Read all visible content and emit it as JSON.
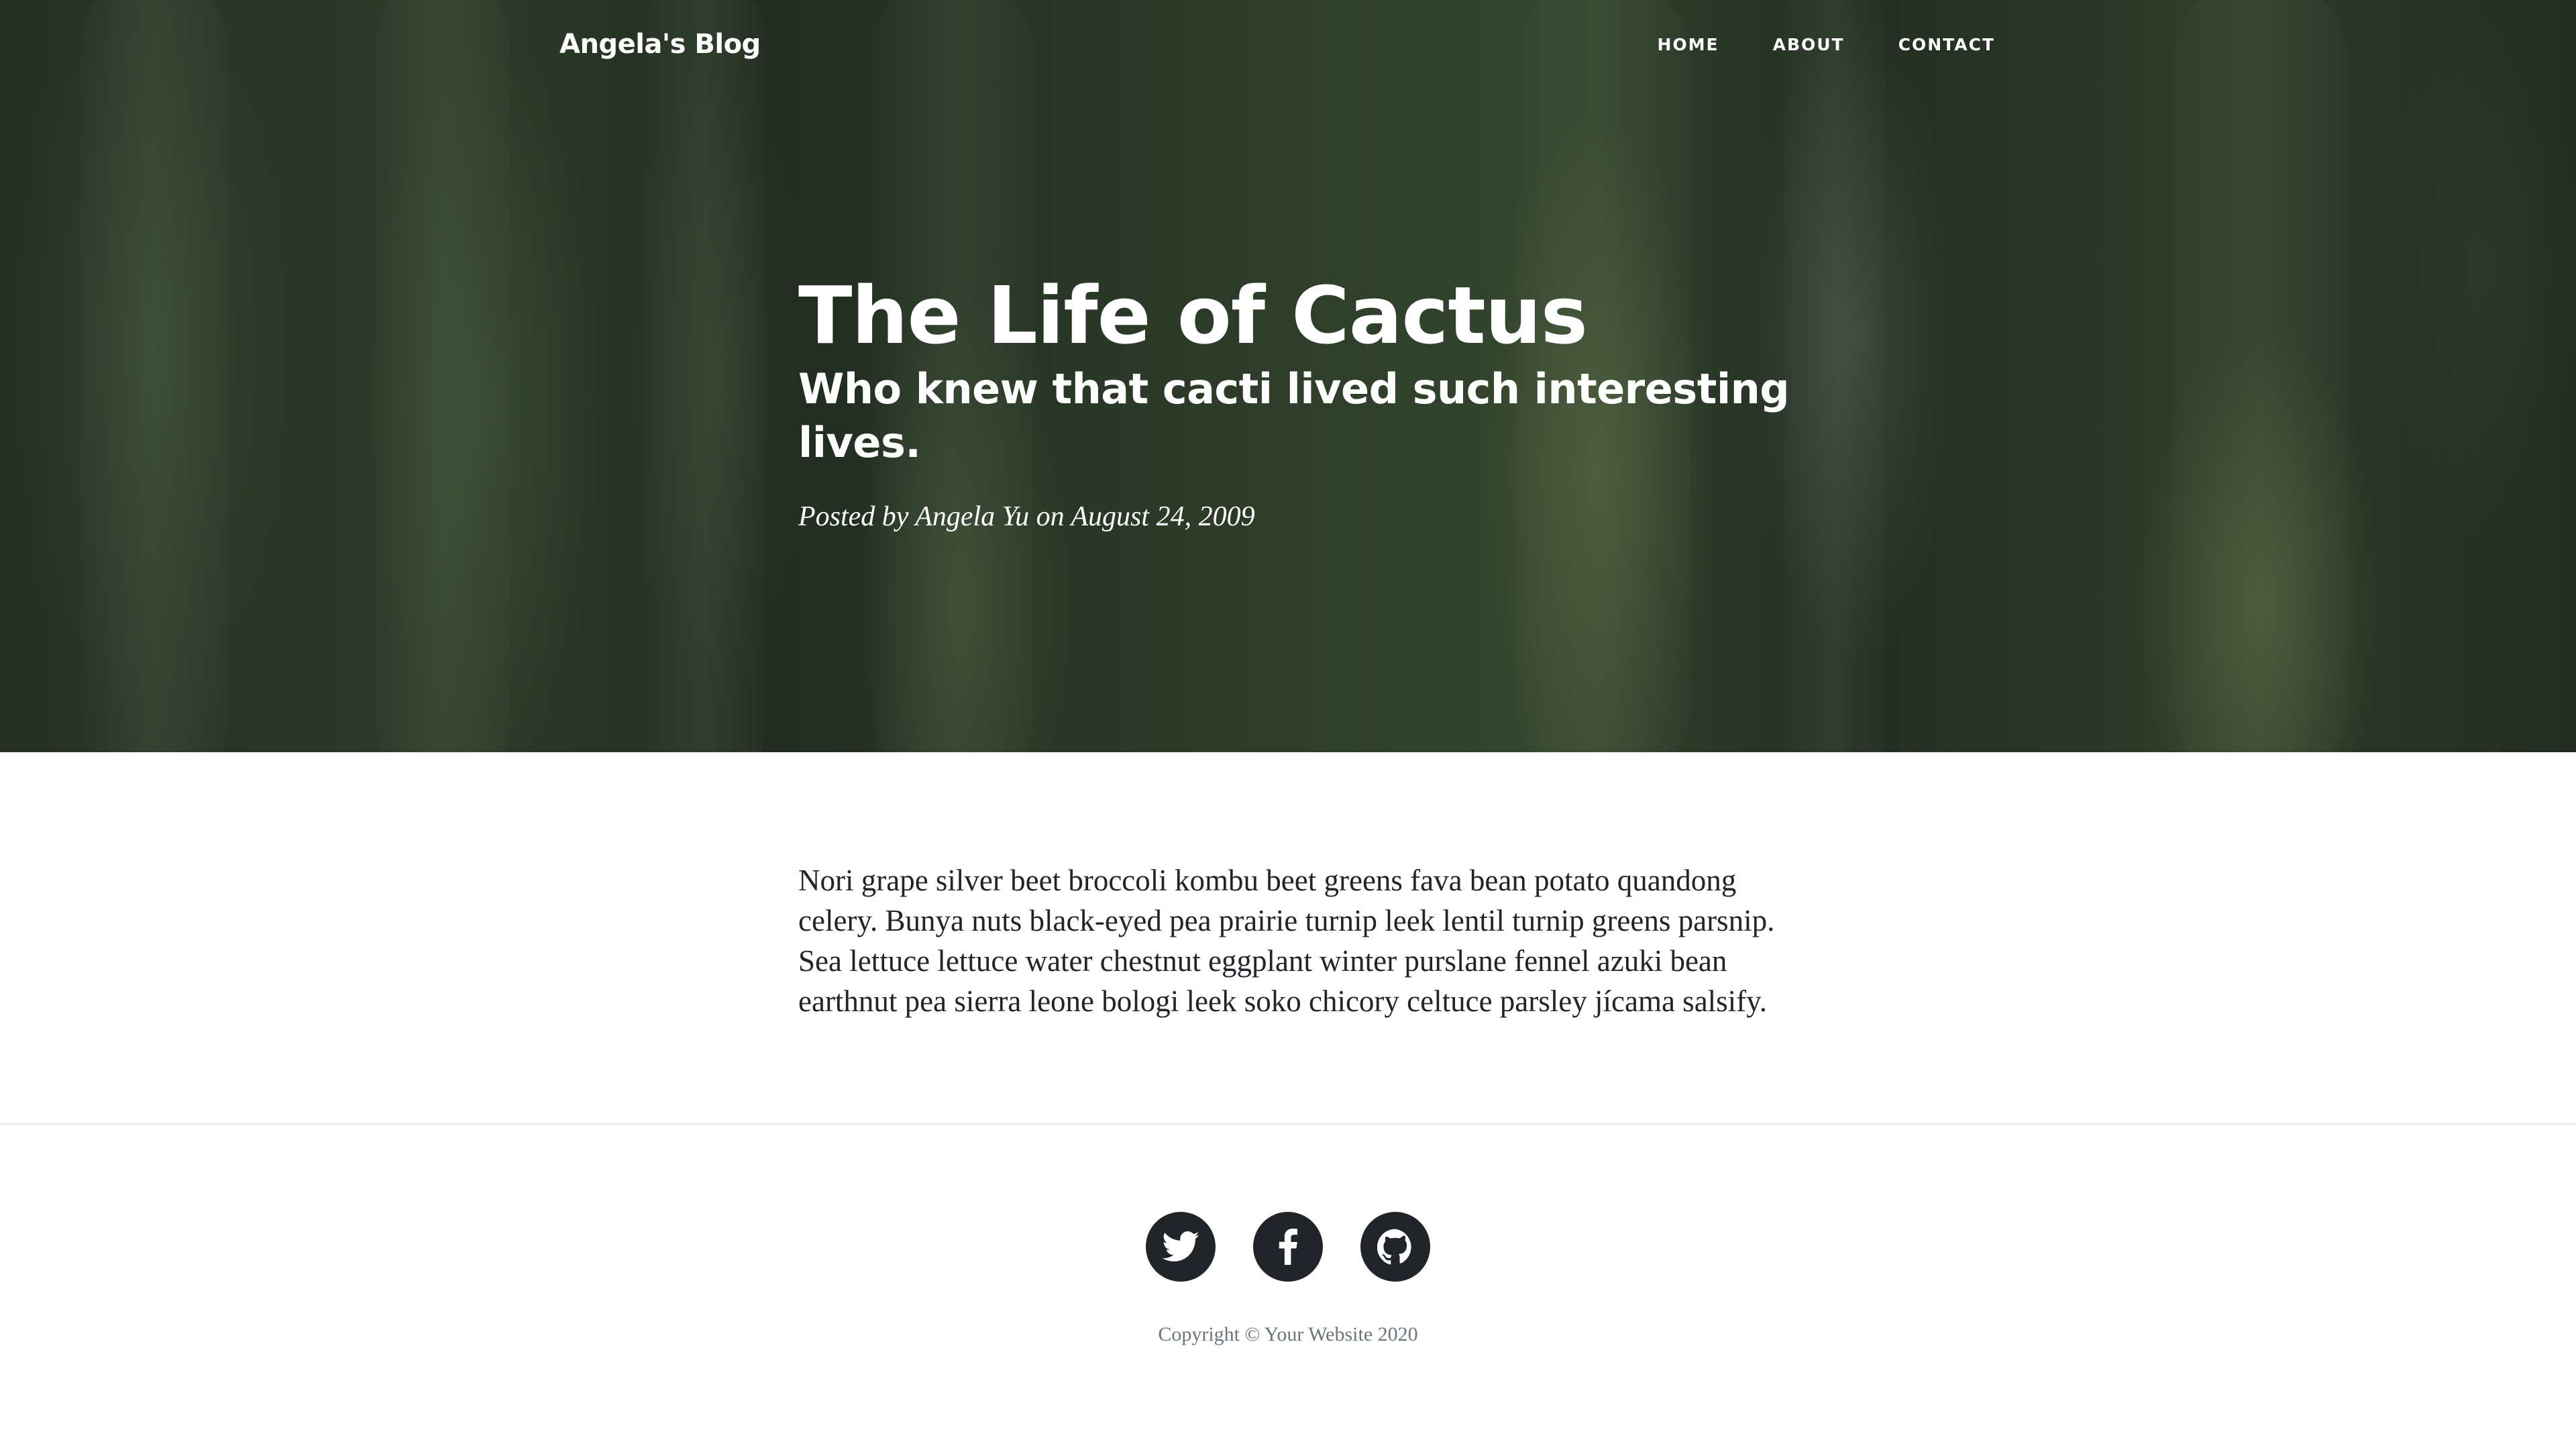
{
  "navbar": {
    "brand": "Angela's Blog",
    "links": [
      "HOME",
      "ABOUT",
      "CONTACT"
    ]
  },
  "post": {
    "title": "The Life of Cactus",
    "subtitle": "Who knew that cacti lived such interesting lives.",
    "meta": "Posted by Angela Yu on August 24, 2009"
  },
  "article": {
    "body": "Nori grape silver beet broccoli kombu beet greens fava bean potato quandong celery. Bunya nuts black-eyed pea prairie turnip leek lentil turnip greens parsnip. Sea lettuce lettuce water chestnut eggplant winter purslane fennel azuki bean earthnut pea sierra leone bologi leek soko chicory celtuce parsley jícama salsify."
  },
  "footer": {
    "social_icons": [
      "twitter-icon",
      "facebook-icon",
      "github-icon"
    ],
    "copyright": "Copyright © Your Website 2020"
  },
  "colors": {
    "social_bg": "#212529",
    "body_text": "#212529",
    "muted_text": "#6c757d"
  }
}
